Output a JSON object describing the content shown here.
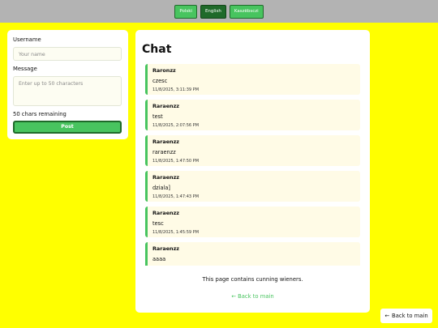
{
  "languages": [
    {
      "label": "Polski",
      "active": false
    },
    {
      "label": "English",
      "active": true
    },
    {
      "label": "Kaszëbsczi",
      "active": false
    }
  ],
  "form": {
    "username_label": "Username",
    "username_placeholder": "Your name",
    "message_label": "Message",
    "message_placeholder": "Enter up to 50 characters",
    "remaining": "50 chars remaining",
    "post_label": "Post"
  },
  "chat": {
    "title": "Chat",
    "messages": [
      {
        "user": "Raronzz",
        "text": "czesc",
        "time": "11/8/2025, 3:11:39 PM"
      },
      {
        "user": "Raraenzz",
        "text": "test",
        "time": "11/8/2025, 2:07:56 PM"
      },
      {
        "user": "Raraenzz",
        "text": "raraenzz",
        "time": "11/8/2025, 1:47:50 PM"
      },
      {
        "user": "Raraenzz",
        "text": "dziala]",
        "time": "11/8/2025, 1:47:43 PM"
      },
      {
        "user": "Raraenzz",
        "text": "tesc",
        "time": "11/8/2025, 1:45:59 PM"
      },
      {
        "user": "Raraenzz",
        "text": "aaaa",
        "time": ""
      }
    ],
    "notice": "This page contains cunning wieners.",
    "back_link": "← Back to main"
  },
  "back_button": {
    "arrow": "←",
    "label": "Back to main"
  }
}
